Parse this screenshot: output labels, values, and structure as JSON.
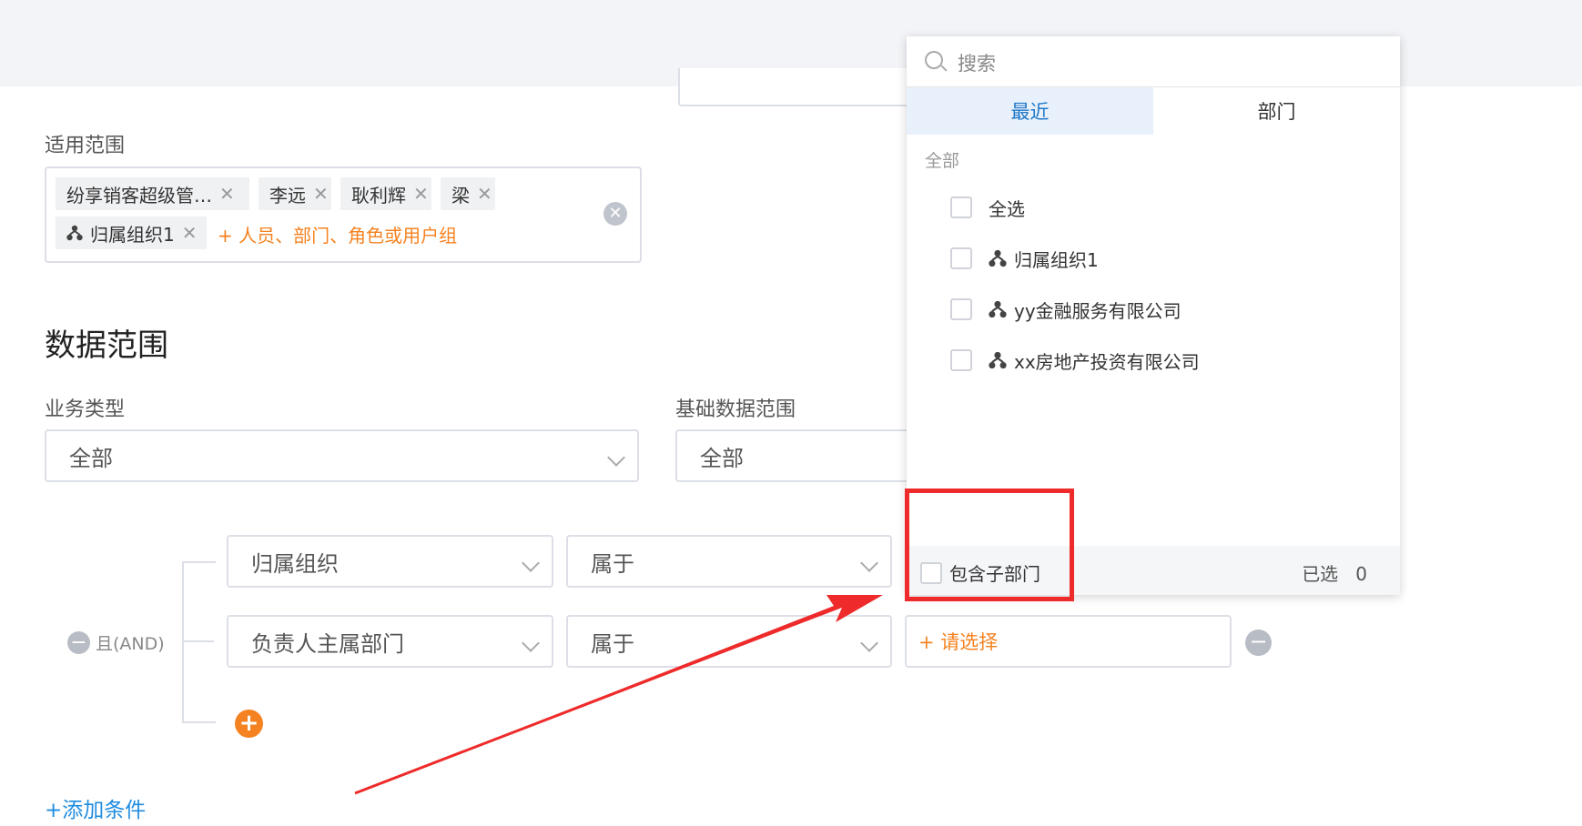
{
  "scope": {
    "label": "适用范围",
    "tags": [
      "纷享销客超级管…",
      "李远",
      "耿利辉",
      "梁",
      "归属组织1"
    ],
    "add_placeholder": "+ 人员、部门、角色或用户组"
  },
  "data_range": {
    "title": "数据范围",
    "business_type": {
      "label": "业务类型",
      "value": "全部"
    },
    "base_range": {
      "label": "基础数据范围",
      "value": "全部"
    }
  },
  "conditions": {
    "logic": "且(AND)",
    "rows": [
      {
        "field": "归属组织",
        "operator": "属于"
      },
      {
        "field": "负责人主属部门",
        "operator": "属于",
        "value_placeholder": "+ 请选择"
      }
    ],
    "add_condition": "+添加条件"
  },
  "picker": {
    "search_placeholder": "搜索",
    "tabs": [
      "最近",
      "部门"
    ],
    "group_label": "全部",
    "options": [
      "全选",
      "归属组织1",
      "yy金融服务有限公司",
      "xx房地产投资有限公司"
    ],
    "include_sub": "包含子部门",
    "selected_label": "已选",
    "selected_count": "0"
  },
  "colors": {
    "accent": "#f58220",
    "link": "#1f8ce0",
    "annotation": "#ee2a2a"
  }
}
